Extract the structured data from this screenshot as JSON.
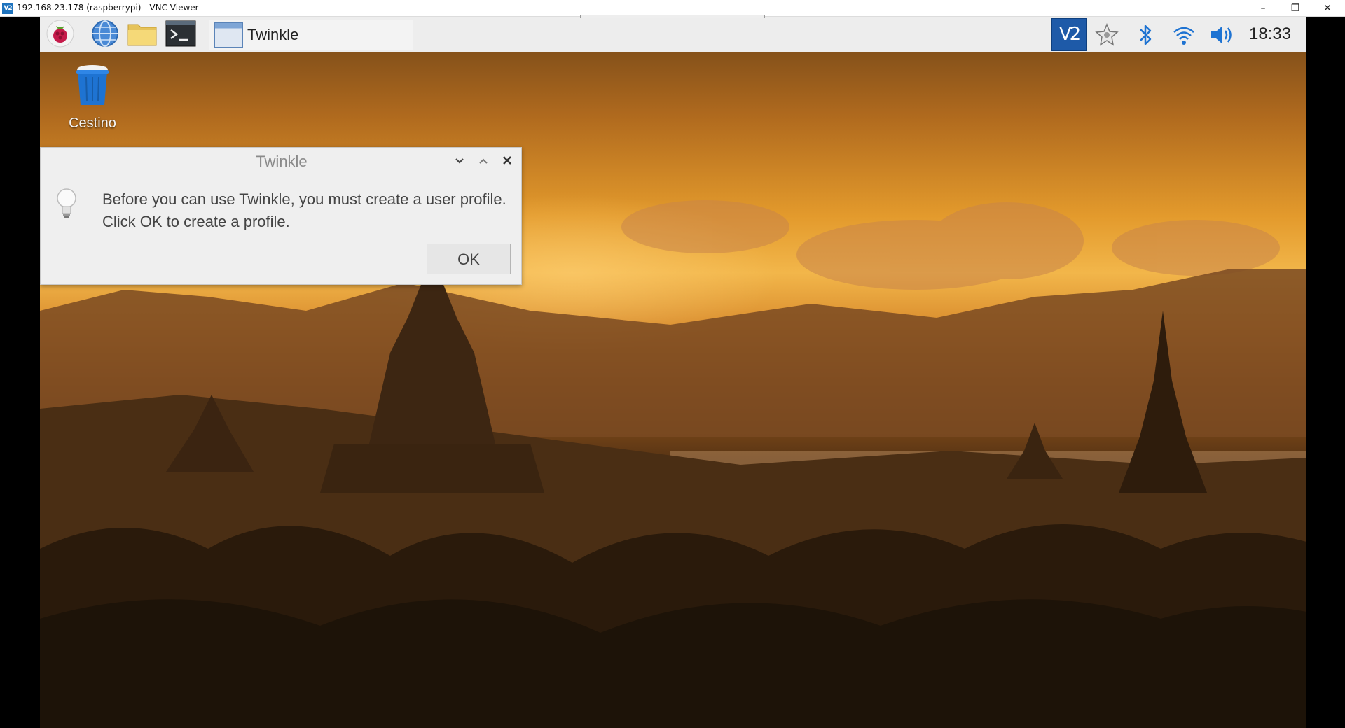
{
  "vnc_viewer": {
    "title": "192.168.23.178 (raspberrypi) - VNC Viewer",
    "app_icon_text": "V2",
    "controls": {
      "minimize": "–",
      "restore": "❐",
      "close": "✕"
    }
  },
  "taskbar": {
    "launchers": [
      {
        "name": "raspberry-menu-icon"
      },
      {
        "name": "web-browser-icon"
      },
      {
        "name": "file-manager-icon"
      },
      {
        "name": "terminal-icon"
      }
    ],
    "task": {
      "label": "Twinkle"
    },
    "tray": {
      "vnc_label": "V2",
      "icons": [
        "star-icon",
        "bluetooth-icon",
        "wifi-icon",
        "volume-icon"
      ],
      "clock": "18:33"
    }
  },
  "desktop": {
    "icons": [
      {
        "label": "Cestino",
        "icon": "trash-icon"
      }
    ]
  },
  "dialog": {
    "title": "Twinkle",
    "message_line1": "Before you can use Twinkle, you must create a user profile.",
    "message_line2": "Click OK to create a profile.",
    "ok_label": "OK",
    "icon": "lightbulb-icon"
  },
  "colors": {
    "taskbar_bg": "#ededed",
    "vnc_accent": "#1e5aa8",
    "dialog_bg": "#efefef"
  }
}
